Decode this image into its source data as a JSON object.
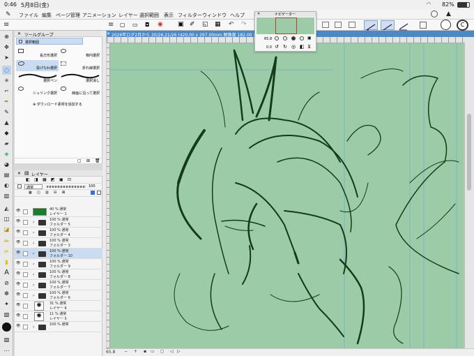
{
  "status": {
    "time": "0:46",
    "date": "5月8日(金)",
    "battery": "82%"
  },
  "menu": [
    "ファイル",
    "編集",
    "ページ管理",
    "アニメーション",
    "レイヤー",
    "選択範囲",
    "表示",
    "フィルター",
    "ウィンドウ",
    "ヘルプ"
  ],
  "tab": {
    "title": "2026年ログ2月から 20/26,21/26 (420.00 x 297.00mm 解像度 182.00 x 257..."
  },
  "tool_panel": {
    "header": "ツールグループ",
    "selected": "選択範囲",
    "tools": [
      "長方形選択",
      "楕円選択",
      "投げなわ選択",
      "折れ線選択",
      "選択ペン",
      "選択消し",
      "シュリンク選択",
      "線画に沿って選択"
    ],
    "add_material": "ダウンロード素材を追加する"
  },
  "layer_panel": {
    "header": "レイヤー",
    "blend_mode": "通常",
    "opacity_value": "100",
    "layers": [
      {
        "pct": "40 % 通常",
        "name": "レイヤー 1",
        "kind": "color"
      },
      {
        "pct": "100 % 通常",
        "name": "フォルダー 5",
        "kind": "folder"
      },
      {
        "pct": "100 % 通常",
        "name": "フォルダー 4",
        "kind": "folder"
      },
      {
        "pct": "100 % 通常",
        "name": "フォルダー 3",
        "kind": "folder"
      },
      {
        "pct": "100 % 通常",
        "name": "フォルダー 10",
        "kind": "folder",
        "selected": true
      },
      {
        "pct": "100 % 通常",
        "name": "フォルダー 9",
        "kind": "folder"
      },
      {
        "pct": "100 % 通常",
        "name": "フォルダー 8",
        "kind": "folder"
      },
      {
        "pct": "100 % 通常",
        "name": "フォルダー 7",
        "kind": "folder"
      },
      {
        "pct": "100 % 通常",
        "name": "フォルダー 6",
        "kind": "folder"
      },
      {
        "pct": "31 % 通常",
        "name": "レイヤー 6",
        "kind": "sketch"
      },
      {
        "pct": "11 % 通常",
        "name": "レイヤー 5",
        "kind": "sketch"
      },
      {
        "pct": "100 % 通常",
        "name": "",
        "kind": "folder"
      }
    ]
  },
  "navigator": {
    "title": "ナビゲーター",
    "zoom": "65.8",
    "rotation": "0.0"
  },
  "bottom_bar": {
    "zoom": "65.8"
  },
  "colors": {
    "canvas_bg": "#9ccba8",
    "ink": "#133b18",
    "selection": "#c9dcf2",
    "tab": "#4a89c8",
    "layer_swatch": "#1e7a2c"
  }
}
